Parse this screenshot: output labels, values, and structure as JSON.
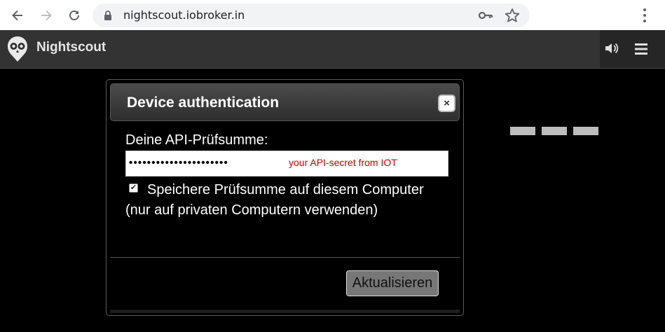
{
  "browser": {
    "url": "nightscout.iobroker.in"
  },
  "header": {
    "app_title": "Nightscout"
  },
  "dialog": {
    "title": "Device authentication",
    "close_label": "×",
    "secret_label": "Deine API-Prüfsumme:",
    "secret_value": "••••••••••••••••••••••",
    "secret_annotation": "your API-secret from IOT",
    "remember_label": "Speichere Prüfsumme auf diesem Computer (nur auf privaten Computern verwenden)",
    "remember_checked": true,
    "update_button": "Aktualisieren"
  },
  "colors": {
    "header_bg": "#333333",
    "annotation_red": "#cc0000"
  }
}
